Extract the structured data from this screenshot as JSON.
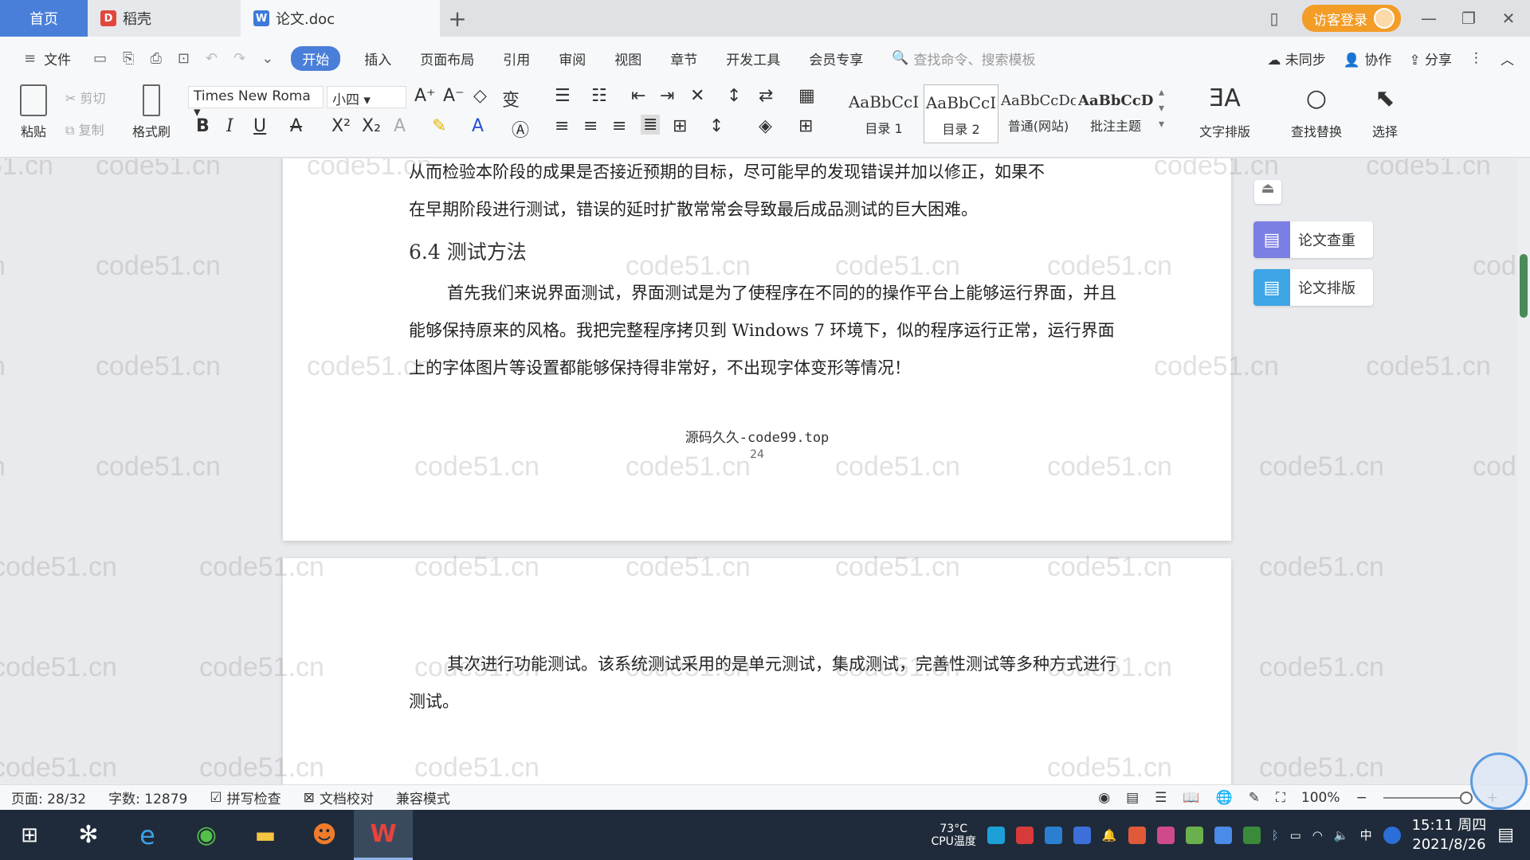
{
  "tabs": {
    "home": "首页",
    "docer": "稻壳",
    "active_doc": "论文.doc",
    "add": "+"
  },
  "window": {
    "login_label": "访客登录"
  },
  "menu": {
    "file": "文件",
    "items": [
      "开始",
      "插入",
      "页面布局",
      "引用",
      "审阅",
      "视图",
      "章节",
      "开发工具",
      "会员专享"
    ],
    "search_placeholder": "查找命令、搜索模板",
    "sync": "未同步",
    "collab": "协作",
    "share": "分享"
  },
  "ribbon": {
    "paste": "粘贴",
    "cut": "剪切",
    "copy": "复制",
    "format_painter": "格式刷",
    "font_name": "Times New Roma",
    "font_size": "小四",
    "styles": [
      {
        "sample": "AaBbCcI",
        "name": "目录 1"
      },
      {
        "sample": "AaBbCcI",
        "name": "目录 2"
      },
      {
        "sample": "AaBbCcDc",
        "name": "普通(网站)"
      },
      {
        "sample": "AaBbCcD",
        "name": "批注主题"
      }
    ],
    "text_layout": "文字排版",
    "find_replace": "查找替换",
    "select": "选择"
  },
  "document": {
    "page1_lines": [
      "从而检验本阶段的成果是否接近预期的目标，尽可能早的发现错误并加以修正，如果不",
      "在早期阶段进行测试，错误的延时扩散常常会导致最后成品测试的巨大困难。"
    ],
    "heading": "6.4 测试方法",
    "para1": "首先我们来说界面测试，界面测试是为了使程序在不同的的操作平台上能够运行界面，并且能够保持原来的风格。我把完整程序拷贝到 Windows 7 环境下，似的程序运行正常，运行界面上的字体图片等设置都能够保持得非常好，不出现字体变形等情况！",
    "footer": "源码久久-code99.top",
    "page_number": "24",
    "para2": "其次进行功能测试。该系统测试采用的是单元测试，集成测试，完善性测试等多种方式进行测试。"
  },
  "watermark_text": "code51.cn",
  "side_panel": {
    "check": "论文查重",
    "layout": "论文排版"
  },
  "status": {
    "page": "页面: 28/32",
    "words": "字数: 12879",
    "spell": "拼写检查",
    "proof": "文档校对",
    "compat": "兼容模式",
    "zoom": "100%"
  },
  "taskbar": {
    "temp": "73°C",
    "temp_label": "CPU温度",
    "ime": "中",
    "time": "15:11 周四",
    "date": "2021/8/26"
  }
}
